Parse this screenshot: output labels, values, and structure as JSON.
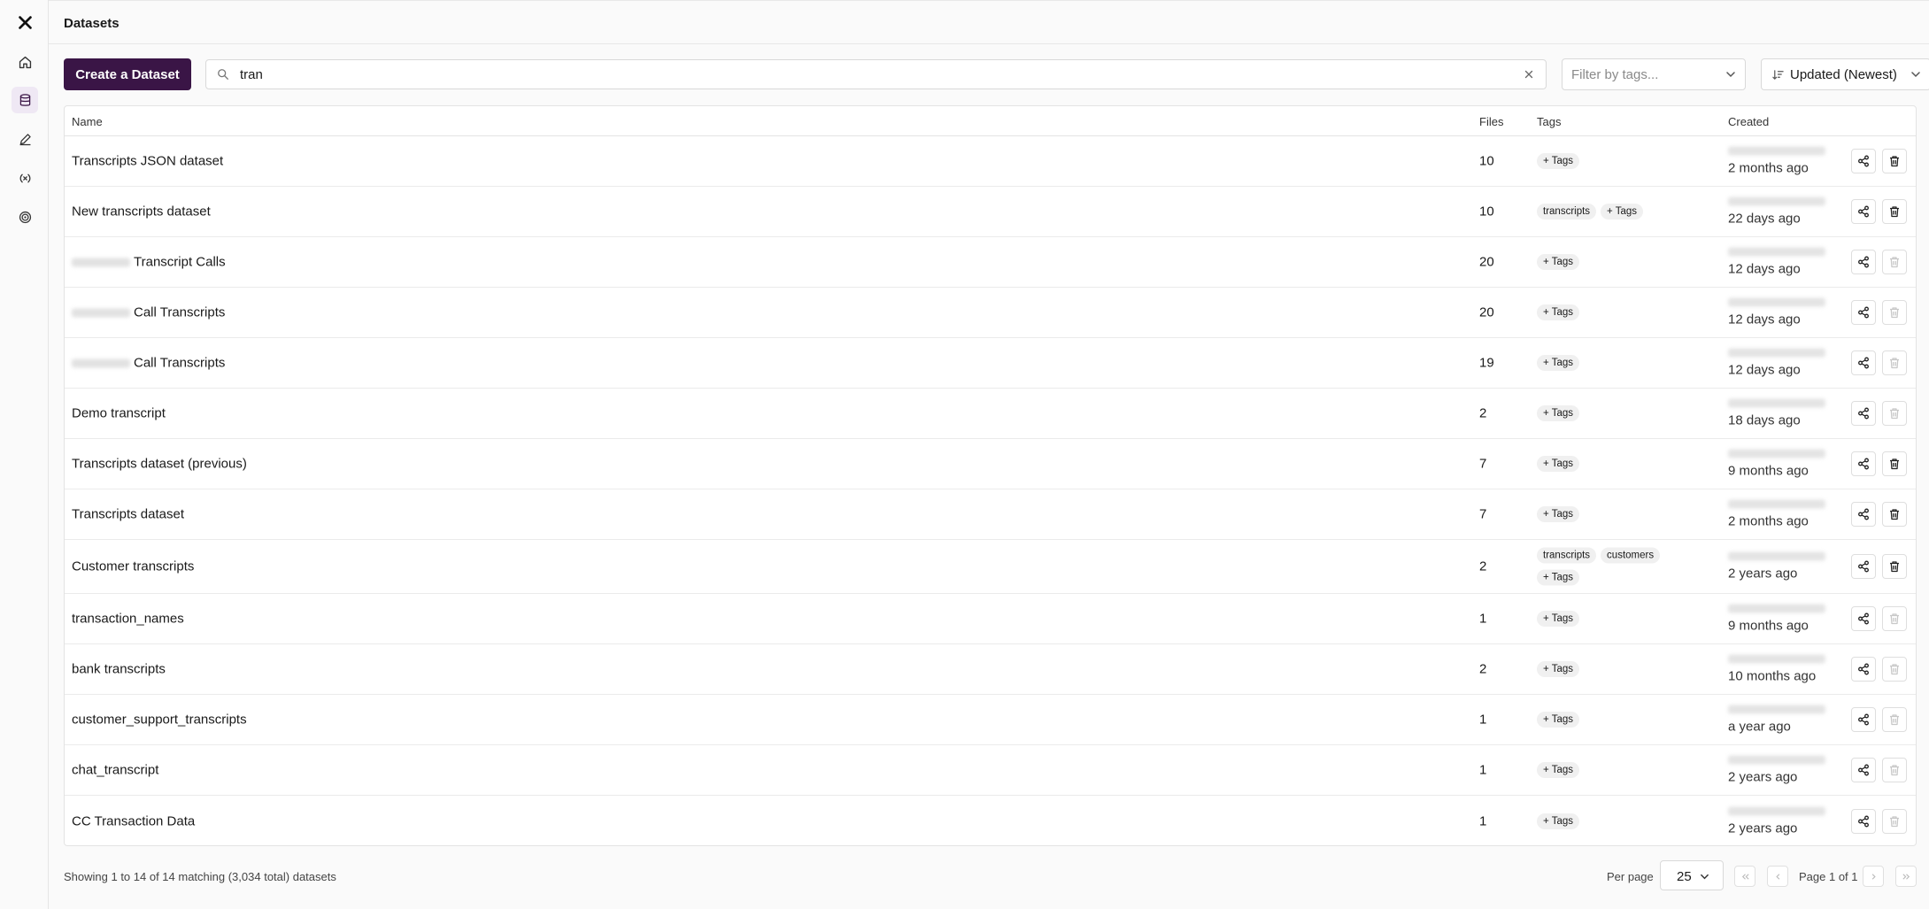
{
  "app": {
    "title": "Datasets"
  },
  "sidebar": {
    "items": [
      {
        "name": "logo",
        "icon": "x-logo-icon"
      },
      {
        "name": "home",
        "icon": "home-icon"
      },
      {
        "name": "datasets",
        "icon": "database-icon",
        "active": true
      },
      {
        "name": "edit",
        "icon": "pencil-icon"
      },
      {
        "name": "functions",
        "icon": "code-variable-icon"
      },
      {
        "name": "targets",
        "icon": "target-icon"
      }
    ]
  },
  "toolbar": {
    "create_label": "Create a Dataset",
    "search_value": "tran",
    "filter_placeholder": "Filter by tags...",
    "sort_value": "Updated (Newest)"
  },
  "table": {
    "headers": {
      "name": "Name",
      "files": "Files",
      "tags": "Tags",
      "created": "Created"
    },
    "rows": [
      {
        "prefix_redacted": false,
        "name": "Transcripts JSON dataset",
        "files": "10",
        "tags": [],
        "add_tag": "+ Tags",
        "created": "2 months ago"
      },
      {
        "prefix_redacted": false,
        "name": "New transcripts dataset",
        "files": "10",
        "tags": [
          "transcripts"
        ],
        "add_tag": "+ Tags",
        "created": "22 days ago"
      },
      {
        "prefix_redacted": true,
        "name": "Transcript Calls",
        "files": "20",
        "tags": [],
        "add_tag": "+ Tags",
        "created": "12 days ago"
      },
      {
        "prefix_redacted": true,
        "name": "Call Transcripts",
        "files": "20",
        "tags": [],
        "add_tag": "+ Tags",
        "created": "12 days ago"
      },
      {
        "prefix_redacted": true,
        "name": "Call Transcripts",
        "files": "19",
        "tags": [],
        "add_tag": "+ Tags",
        "created": "12 days ago"
      },
      {
        "prefix_redacted": false,
        "name": "Demo transcript",
        "files": "2",
        "tags": [],
        "add_tag": "+ Tags",
        "created": "18 days ago"
      },
      {
        "prefix_redacted": false,
        "name": "Transcripts dataset (previous)",
        "files": "7",
        "tags": [],
        "add_tag": "+ Tags",
        "created": "9 months ago"
      },
      {
        "prefix_redacted": false,
        "name": "Transcripts dataset",
        "files": "7",
        "tags": [],
        "add_tag": "+ Tags",
        "created": "2 months ago"
      },
      {
        "prefix_redacted": false,
        "name": "Customer transcripts",
        "files": "2",
        "tags": [
          "transcripts",
          "customers"
        ],
        "add_tag": "+ Tags",
        "created": "2 years ago"
      },
      {
        "prefix_redacted": false,
        "name": "transaction_names",
        "files": "1",
        "tags": [],
        "add_tag": "+ Tags",
        "created": "9 months ago"
      },
      {
        "prefix_redacted": false,
        "name": "bank transcripts",
        "files": "2",
        "tags": [],
        "add_tag": "+ Tags",
        "created": "10 months ago"
      },
      {
        "prefix_redacted": false,
        "name": "customer_support_transcripts",
        "files": "1",
        "tags": [],
        "add_tag": "+ Tags",
        "created": "a year ago"
      },
      {
        "prefix_redacted": false,
        "name": "chat_transcript",
        "files": "1",
        "tags": [],
        "add_tag": "+ Tags",
        "created": "2 years ago"
      },
      {
        "prefix_redacted": false,
        "name": "CC Transaction Data",
        "files": "1",
        "tags": [],
        "add_tag": "+ Tags",
        "created": "2 years ago"
      }
    ]
  },
  "footer": {
    "summary": "Showing 1 to 14 of 14 matching (3,034 total) datasets",
    "per_page_label": "Per page",
    "per_page_value": "25",
    "page_info": "Page 1 of 1"
  },
  "colors": {
    "brand": "#3a1546",
    "active_nav": "#efe8f4"
  }
}
